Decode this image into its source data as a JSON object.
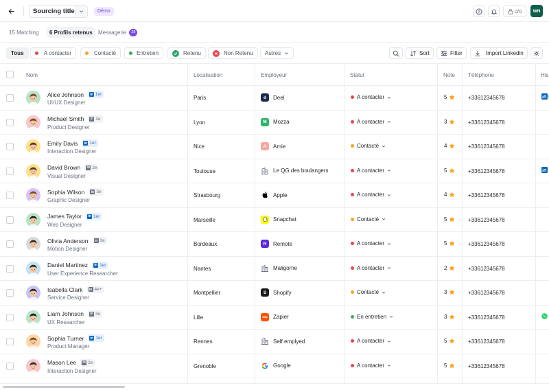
{
  "header": {
    "title": "Sourcing title",
    "badge": "Démo",
    "credits": "0/0",
    "user_initials": "WN"
  },
  "tabs": [
    {
      "label": "15 Matching"
    },
    {
      "label": "6 Profils retenus"
    },
    {
      "label": "Messagerie",
      "count": "28"
    }
  ],
  "filters": {
    "all": "Tous",
    "items": [
      {
        "label": "A contacter",
        "color": "#e5484d"
      },
      {
        "label": "Contacté",
        "color": "#f5a524"
      },
      {
        "label": "Entretien",
        "color": "#46a758"
      },
      {
        "label": "Retenu",
        "icon": "check-circle-icon",
        "color": "#30a46c"
      },
      {
        "label": "Non Retenu",
        "icon": "x-circle-icon",
        "color": "#e5484d"
      }
    ],
    "others": "Autres"
  },
  "tools": {
    "sort": "Sort",
    "filter": "Filter",
    "import": "Import Linkedin"
  },
  "columns": {
    "name": "Nom",
    "location": "Localisation",
    "employer": "Employeur",
    "status": "Statut",
    "note": "Note",
    "phone": "Téléphone",
    "history": "His"
  },
  "rows": [
    {
      "name": "Alice Johnson",
      "degree": "1er",
      "role": "UI/UX Designer",
      "location": "Paris",
      "employer": "Deel",
      "logo": "d",
      "logo_bg": "#1b2a4a",
      "status": "A contacter",
      "status_color": "#e5484d",
      "note": "5",
      "phone": "+33612345678",
      "avatar_bg": "#b7e4c7",
      "hist": [
        "linkedin",
        "whatsapp"
      ]
    },
    {
      "name": "Michael Smith",
      "degree": "2e",
      "role": "Product Designer",
      "location": "Lyon",
      "employer": "Mozza",
      "logo": "M",
      "logo_bg": "#2fb56a",
      "status": "A contacter",
      "status_color": "#e5484d",
      "note": "3",
      "phone": "+33612345678",
      "avatar_bg": "#f8c6cc",
      "hist": []
    },
    {
      "name": "Emily Davis",
      "degree": "1er",
      "role": "Interaction Designer",
      "location": "Nice",
      "employer": "Amie",
      "logo": "A",
      "logo_bg": "#f7a7a0",
      "status": "Contacté",
      "status_color": "#f5a524",
      "note": "4",
      "phone": "+33612345678",
      "avatar_bg": "#ffe08a",
      "hist": []
    },
    {
      "name": "David Brown",
      "degree": "2e",
      "role": "Visual Designer",
      "location": "Toulouse",
      "employer": "Le QG des boulangers",
      "logo": "",
      "logo_bg": "",
      "status": "A contacter",
      "status_color": "#e5484d",
      "note": "5",
      "phone": "+33612345678",
      "avatar_bg": "#ffe08a",
      "hist": [
        "linkedin"
      ]
    },
    {
      "name": "Sophia Wilson",
      "degree": "3e",
      "role": "Graphic Designer",
      "location": "Strasbourg",
      "employer": "Apple",
      "logo": "",
      "logo_bg": "#ffffff",
      "status": "A contacter",
      "status_color": "#e5484d",
      "note": "4",
      "phone": "+33612345678",
      "avatar_bg": "#d7c2f4",
      "hist": []
    },
    {
      "name": "James Taylor",
      "degree": "1er",
      "role": "Web Designer",
      "location": "Marseille",
      "employer": "Snapchat",
      "logo": "",
      "logo_bg": "#fffc00",
      "status": "Contacté",
      "status_color": "#f5a524",
      "note": "5",
      "phone": "+33612345678",
      "avatar_bg": "#b7e4c7",
      "hist": []
    },
    {
      "name": "Olivia Anderson",
      "degree": "3e",
      "role": "Motion Designer",
      "location": "Bordeaux",
      "employer": "Remote",
      "logo": "R",
      "logo_bg": "#5b2bd9",
      "status": "A contacter",
      "status_color": "#e5484d",
      "note": "5",
      "phone": "+33612345678",
      "avatar_bg": "#d9d9d9",
      "hist": []
    },
    {
      "name": "Daniel Martinez",
      "degree": "1er",
      "role": "User Experience Researcher",
      "location": "Nantes",
      "employer": "Maligorne",
      "logo": "",
      "logo_bg": "",
      "status": "A contacter",
      "status_color": "#e5484d",
      "note": "2",
      "phone": "+33612345678",
      "avatar_bg": "#bfe3f5",
      "hist": []
    },
    {
      "name": "Isabella Clark",
      "degree": "4e+",
      "role": "Service Designer",
      "location": "Montpellier",
      "employer": "Shopify",
      "logo": "S",
      "logo_bg": "#1a1a1a",
      "status": "Contacté",
      "status_color": "#f5a524",
      "note": "3",
      "phone": "+33612345678",
      "avatar_bg": "#c9c2f4",
      "hist": []
    },
    {
      "name": "Liam Johnson",
      "degree": "3e",
      "role": "UX Researcher",
      "location": "Lille",
      "employer": "Zapier",
      "logo": "zap",
      "logo_bg": "#ff4f00",
      "status": "En entretien",
      "status_color": "#46a758",
      "note": "3",
      "phone": "+33612345678",
      "avatar_bg": "#b7e4c7",
      "hist": [
        "whatsapp"
      ]
    },
    {
      "name": "Sophia Turner",
      "degree": "1er",
      "role": "Product Manager",
      "location": "Rennes",
      "employer": "Self emplyed",
      "logo": "",
      "logo_bg": "",
      "status": "A contacter",
      "status_color": "#e5484d",
      "note": "5",
      "phone": "+33612345678",
      "avatar_bg": "#ffd6a5",
      "hist": []
    },
    {
      "name": "Mason Lee",
      "degree": "2e",
      "role": "Interaction Designer",
      "location": "Grenoble",
      "employer": "Google",
      "logo": "G",
      "logo_bg": "#ffffff",
      "status": "A contacter",
      "status_color": "#e5484d",
      "note": "5",
      "phone": "+33612345678",
      "avatar_bg": "#f8c6cc",
      "hist": []
    }
  ]
}
